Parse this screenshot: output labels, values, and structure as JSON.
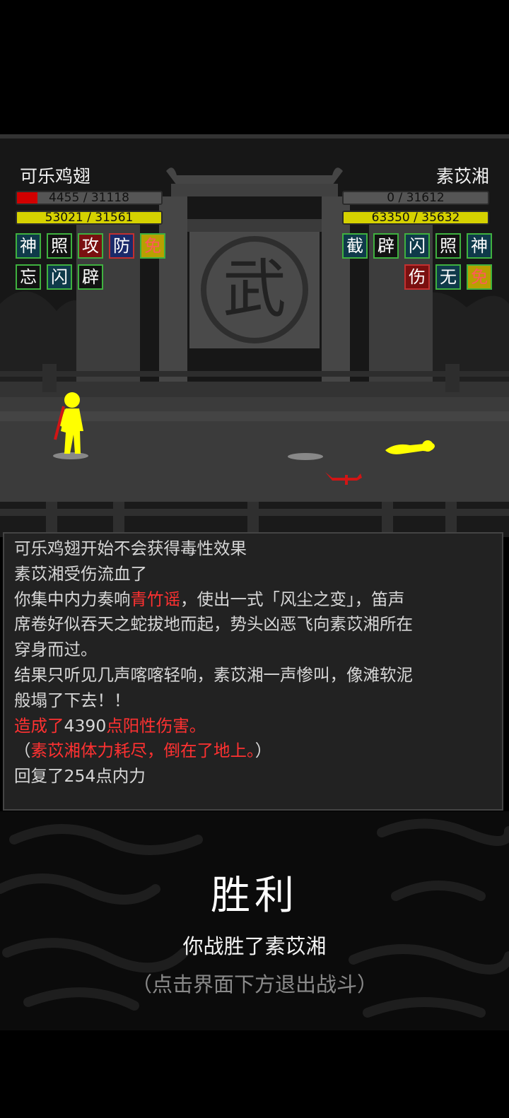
{
  "player": {
    "name": "可乐鸡翅",
    "hp_text": "4455 / 31118",
    "hp_fraction": 0.14,
    "mp_text": "53021 / 31561",
    "mp_fraction": 1.0,
    "skills": [
      {
        "char": "神",
        "border": "#3fb13f",
        "color": "#ffffff",
        "bg": "#0f3a4a"
      },
      {
        "char": "照",
        "border": "#3fb13f",
        "color": "#ffffff",
        "bg": "#121212"
      },
      {
        "char": "攻",
        "border": "#3fb13f",
        "color": "#ffffff",
        "bg": "#7a1010"
      },
      {
        "char": "防",
        "border": "#c23030",
        "color": "#ffffff",
        "bg": "#1b2a6a"
      },
      {
        "char": "免",
        "border": "#3fb13f",
        "color": "#ff5a5a",
        "bg": "#b8a000"
      },
      {
        "char": "忘",
        "border": "#3fb13f",
        "color": "#ffffff",
        "bg": "#121212"
      },
      {
        "char": "闪",
        "border": "#3fb13f",
        "color": "#ffffff",
        "bg": "#0f3a4a"
      },
      {
        "char": "辟",
        "border": "#3fb13f",
        "color": "#ffffff",
        "bg": "#121212"
      }
    ]
  },
  "enemy": {
    "name": "素苡湘",
    "hp_text": "0 / 31612",
    "hp_fraction": 0.0,
    "mp_text": "63350 / 35632",
    "mp_fraction": 1.0,
    "skills": [
      {
        "char": "截",
        "border": "#3fb13f",
        "color": "#ffffff",
        "bg": "#0f3a4a"
      },
      {
        "char": "辟",
        "border": "#3fb13f",
        "color": "#ffffff",
        "bg": "#121212"
      },
      {
        "char": "闪",
        "border": "#3fb13f",
        "color": "#ffffff",
        "bg": "#0f3a4a"
      },
      {
        "char": "照",
        "border": "#3fb13f",
        "color": "#ffffff",
        "bg": "#121212"
      },
      {
        "char": "神",
        "border": "#3fb13f",
        "color": "#ffffff",
        "bg": "#0f3a4a"
      },
      {
        "char": "",
        "border": "",
        "color": "",
        "bg": ""
      },
      {
        "char": "",
        "border": "",
        "color": "",
        "bg": ""
      },
      {
        "char": "伤",
        "border": "#c23030",
        "color": "#ffffff",
        "bg": "#7a1010"
      },
      {
        "char": "无",
        "border": "#3fb13f",
        "color": "#ffffff",
        "bg": "#0f3a4a"
      },
      {
        "char": "免",
        "border": "#3fb13f",
        "color": "#ff5a5a",
        "bg": "#b8a000"
      }
    ]
  },
  "scene": {
    "gate_sign": "武",
    "colors": {
      "hp": "#d10000",
      "mp": "#d6d200",
      "figure": "#ffff00",
      "weapon": "#d11515"
    }
  },
  "log": {
    "lines": [
      [
        {
          "t": "可乐鸡翅开始不会获得毒性效果",
          "red": false
        }
      ],
      [
        {
          "t": "素苡湘受伤流血了",
          "red": false
        }
      ],
      [
        {
          "t": "你集中内力奏响",
          "red": false
        },
        {
          "t": "青竹谣",
          "red": true
        },
        {
          "t": "，使出一式「风尘之变」，笛声",
          "red": false
        }
      ],
      [
        {
          "t": "席卷好似吞天之蛇拔地而起，势头凶恶飞向素苡湘所在",
          "red": false
        }
      ],
      [
        {
          "t": "穿身而过。",
          "red": false
        }
      ],
      [
        {
          "t": "结果只听见几声喀喀轻响，素苡湘一声惨叫，像滩软泥",
          "red": false
        }
      ],
      [
        {
          "t": "般塌了下去！！",
          "red": false
        }
      ],
      [
        {
          "t": "造成了",
          "red": true
        },
        {
          "t": "4390",
          "red": false
        },
        {
          "t": "点阳性伤害。",
          "red": true
        }
      ],
      [
        {
          "t": "（",
          "red": false
        },
        {
          "t": "素苡湘体力耗尽，倒在了地上。",
          "red": true
        },
        {
          "t": "）",
          "red": false
        }
      ],
      [
        {
          "t": "回复了254点内力",
          "red": false
        }
      ]
    ]
  },
  "result": {
    "title": "胜利",
    "subtitle": "你战胜了素苡湘",
    "hint": "（点击界面下方退出战斗）"
  }
}
